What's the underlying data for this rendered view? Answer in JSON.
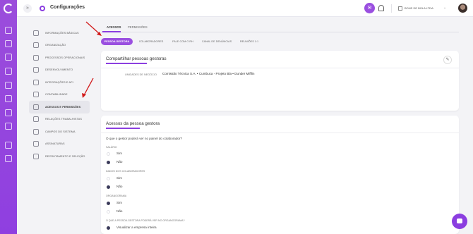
{
  "header": {
    "title": "Configurações",
    "company": "BONS DE BOLA LTDA."
  },
  "menu": {
    "items": [
      {
        "label": "INFORMAÇÕES BÁSICAS",
        "icon": "info-icon"
      },
      {
        "label": "ORGANIZAÇÃO",
        "icon": "org-icon"
      },
      {
        "label": "PROCESSOS OPERACIONAIS",
        "icon": "process-icon"
      },
      {
        "label": "DESENVOLVIMENTO",
        "icon": "development-icon"
      },
      {
        "label": "INTEGRAÇÕES E API",
        "icon": "integration-icon"
      },
      {
        "label": "CONTABILIDADE",
        "icon": "accounting-icon"
      },
      {
        "label": "ACESSOS E PERMISSÕES",
        "icon": "shield-icon",
        "active": true
      },
      {
        "label": "RELAÇÕES TRABALHISTAS",
        "icon": "labor-icon"
      },
      {
        "label": "CAMPOS DO SISTEMA",
        "icon": "fields-icon"
      },
      {
        "label": "ASSINATURAS",
        "icon": "signature-icon"
      },
      {
        "label": "RECRUTAMENTO E SELEÇÃO",
        "icon": "recruiting-icon"
      }
    ]
  },
  "tabs": [
    "ACESSOS",
    "PERMISSÕES"
  ],
  "pills": [
    "PESSOA GESTORA",
    "COLABORADORES",
    "FALE COM O RH",
    "CANAL DE DENÚNCIAS",
    "REUNIÕES 1:1"
  ],
  "card1": {
    "title": "Compartilhar pessoas gestoras",
    "label": "UNIDADES DE NEGÓCIO",
    "value": "Comissão Técnica S.A. • Cumbuca - Projeto Bla • Dunder Mifflin"
  },
  "card2": {
    "title": "Acessos da pessoa gestora",
    "question": "O que o gestor poderá ver no painel do colaborador?",
    "groups": [
      {
        "label": "SALÁRIO",
        "options": [
          {
            "label": "Sim",
            "checked": false
          },
          {
            "label": "Não",
            "checked": true
          }
        ]
      },
      {
        "label": "DADOS DOS COLABORADORES",
        "options": [
          {
            "label": "Sim",
            "checked": false
          },
          {
            "label": "Não",
            "checked": true
          }
        ]
      },
      {
        "label": "ORGANOGRAMA",
        "options": [
          {
            "label": "Sim",
            "checked": true
          },
          {
            "label": "Não",
            "checked": false
          }
        ]
      },
      {
        "label": "O QUE A PESSOA GESTORA PODERÁ VER NO ORGANOGRAMA?",
        "options": [
          {
            "label": "Visualizar a empresa inteira",
            "checked": true
          }
        ]
      }
    ]
  },
  "colors": {
    "accent": "#8b3ee0",
    "rail": "#9b4ddb",
    "arrow": "#d11a1a"
  }
}
